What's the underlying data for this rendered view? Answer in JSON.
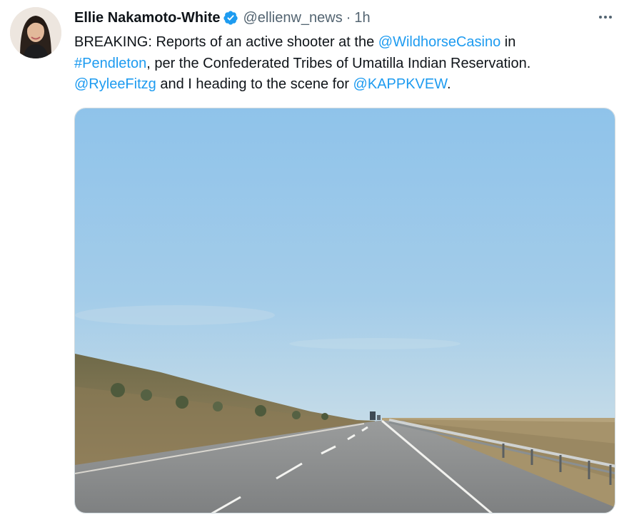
{
  "author": {
    "name": "Ellie Nakamoto-White",
    "handle": "@ellienw_news",
    "separator": "·",
    "time": "1h",
    "verified": true
  },
  "tweet": {
    "line1_prefix": "BREAKING: Reports of an active shooter at the ",
    "mention_casino": "@WildhorseCasino",
    "line1_suffix": " in",
    "hashtag_city": "#Pendleton",
    "line2_rest": ", per the Confederated Tribes of Umatilla Indian Reservation.",
    "mention_rylee": "@RyleeFitzg",
    "line3_middle": " and I heading to the scene for ",
    "mention_station": "@KAPPKVEW",
    "line3_end": "."
  },
  "icons": {
    "verified": "verified-badge-icon",
    "more": "more-options-icon"
  },
  "colors": {
    "link": "#1d9bf0",
    "text": "#0f1419",
    "muted": "#536471",
    "verified": "#1d9bf0"
  }
}
